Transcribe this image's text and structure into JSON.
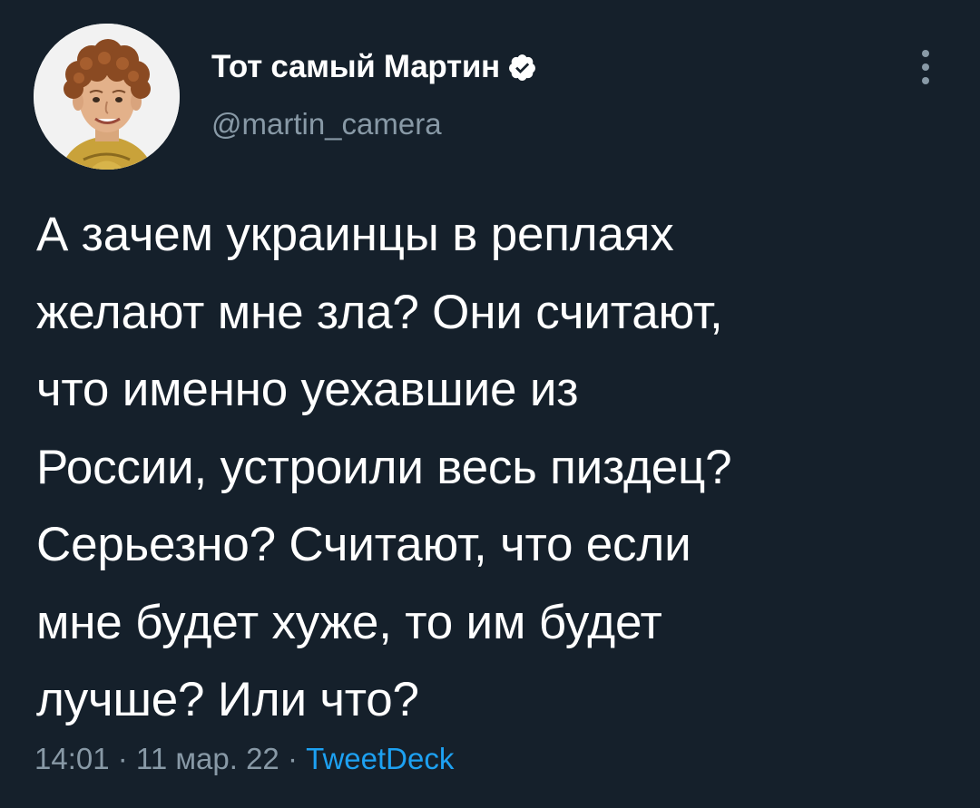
{
  "author": {
    "display_name": "Тот самый Мартин",
    "handle": "@martin_camera",
    "verified": true,
    "avatar_icon": "avatar-photo"
  },
  "menu": {
    "icon": "more-vertical-icon"
  },
  "tweet": {
    "lines": [
      "А зачем украинцы в реплаях",
      "желают мне зла? Они считают,",
      "что именно уехавшие из",
      "России, устроили весь пиздец?",
      "Серьезно? Считают, что если",
      "мне будет хуже, то им будет",
      "лучше? Или что?"
    ]
  },
  "meta": {
    "time": "14:01",
    "sep1": " · ",
    "date": "11 мар. 22",
    "sep2": " · ",
    "source": "TweetDeck"
  },
  "colors": {
    "background": "#15202b",
    "text": "#ffffff",
    "secondary": "#8899a6",
    "link": "#1da1f2"
  }
}
